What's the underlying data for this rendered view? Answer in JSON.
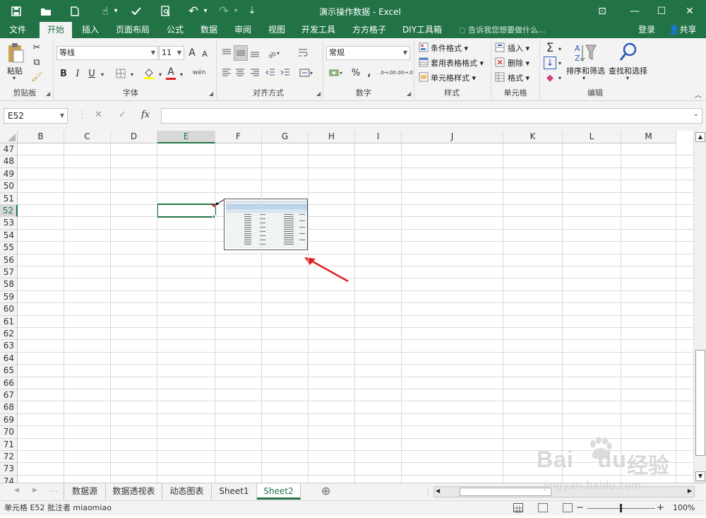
{
  "titlebar": {
    "title": "演示操作数据 - Excel",
    "quick_access_icons": [
      "save-icon",
      "open-icon",
      "new-icon",
      "touch-icon",
      "spellcheck-icon",
      "print-preview-icon",
      "undo-icon",
      "redo-icon",
      "customize-icon"
    ],
    "window_buttons": [
      "ribbon-display-icon",
      "minimize-icon",
      "maximize-icon",
      "close-icon"
    ],
    "glyphs": {
      "save": "💾",
      "open": "📂",
      "new": "🗋",
      "touch": "☝",
      "spellcheck": "✓",
      "preview": "🔍",
      "undo": "↶",
      "redo": "↷",
      "more": "⇣",
      "ribbon": "⊡",
      "min": "—",
      "max": "☐",
      "close": "✕",
      "dropdown": "▾"
    }
  },
  "ribbon_tabs": {
    "file": "文件",
    "home": "开始",
    "insert": "插入",
    "page_layout": "页面布局",
    "formulas": "公式",
    "data": "数据",
    "review": "审阅",
    "view": "视图",
    "developer": "开发工具",
    "fangfang": "方方格子",
    "diy": "DIY工具箱",
    "tell_me": "告诉我您想要做什么...",
    "login": "登录",
    "share": "共享"
  },
  "ribbon": {
    "clipboard": {
      "paste": "粘贴",
      "label": "剪贴板"
    },
    "font": {
      "name": "等线",
      "size": "11",
      "label": "字体",
      "bold": "B",
      "italic": "I",
      "underline": "U",
      "grow": "A",
      "shrink": "A",
      "phonetic": "wén",
      "font_color_letter": "A"
    },
    "alignment": {
      "label": "对齐方式"
    },
    "number": {
      "format": "常规",
      "label": "数字",
      "percent": "%",
      "comma": ",",
      "dec_inc": ".0→.00",
      "dec_dec": ".00→.0"
    },
    "styles": {
      "conditional": "条件格式",
      "table": "套用表格格式",
      "cell": "单元格样式",
      "label": "样式"
    },
    "cells": {
      "insert": "插入",
      "delete": "删除",
      "format": "格式",
      "label": "单元格"
    },
    "editing": {
      "sort": "排序和筛选",
      "find": "查找和选择",
      "label": "编辑",
      "autosum": "Σ",
      "fill": "↓",
      "clear": "◆"
    }
  },
  "formula_bar": {
    "name_box": "E52",
    "value": "",
    "fx": "fx",
    "cancel": "✕",
    "enter": "✓"
  },
  "columns": [
    "B",
    "C",
    "D",
    "E",
    "F",
    "G",
    "H",
    "I",
    "J",
    "K",
    "L",
    "M"
  ],
  "rows": [
    "47",
    "48",
    "49",
    "50",
    "51",
    "52",
    "53",
    "54",
    "55",
    "56",
    "57",
    "58",
    "59",
    "60",
    "61",
    "62",
    "63",
    "64",
    "65",
    "66",
    "67",
    "68",
    "69",
    "70",
    "71",
    "72",
    "73",
    "74"
  ],
  "selected_cell": "E52",
  "sheet_tabs": [
    "数据源",
    "数据透视表",
    "动态图表",
    "Sheet1",
    "Sheet2"
  ],
  "active_sheet": "Sheet2",
  "add_sheet": "⊕",
  "status": {
    "text": "单元格 E52 批注者 miaomiao",
    "zoom": "100%"
  },
  "watermark": {
    "brand": "Bai",
    "brand_suffix": "du",
    "cn": "经验",
    "url": "jingyan.baidu.com"
  },
  "colors": {
    "accent": "#217346",
    "arrow": "#e02020"
  }
}
